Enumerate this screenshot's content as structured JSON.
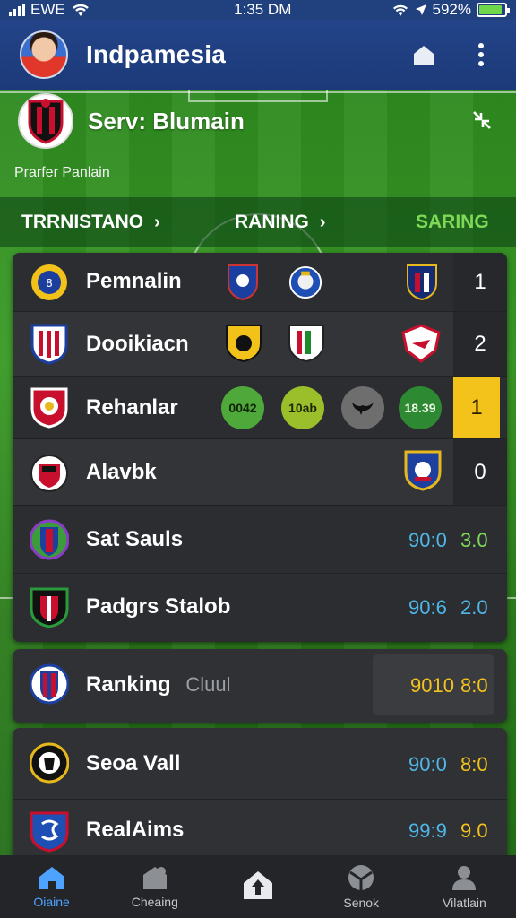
{
  "status_bar": {
    "carrier": "EWE",
    "time": "1:35 DM",
    "battery": "592%"
  },
  "header": {
    "title": "Indpamesia",
    "icons": [
      "avatar",
      "home-outline-icon",
      "more-vertical-icon"
    ]
  },
  "hero": {
    "title": "Serv: Blumain",
    "subtitle": "Prarfer Panlain"
  },
  "tabs": [
    {
      "label": "TRRNISTANO",
      "chevron": "›"
    },
    {
      "label": "RANING",
      "chevron": "›"
    },
    {
      "label": "SARING"
    }
  ],
  "rows": [
    {
      "name": "Pemnalin",
      "rank": "1"
    },
    {
      "name": "Dooikiacn",
      "rank": "2"
    },
    {
      "name": "Rehanlar",
      "rank": "1",
      "pills": [
        "0042",
        "10ab",
        "",
        "18.39"
      ]
    },
    {
      "name": "Alavbk",
      "rank": "0"
    },
    {
      "name": "Sat Sauls",
      "score_a": "90:0",
      "score_b": "3.0"
    },
    {
      "name": "Padgrs Stalob",
      "score_a": "90:6",
      "score_b": "2.0"
    }
  ],
  "featured": {
    "name": "Ranking",
    "suffix": "Cluul",
    "score_a": "9010",
    "score_b": "8:0"
  },
  "lower_rows": [
    {
      "name": "Seoa Vall",
      "score_a": "90:0",
      "score_b": "8:0"
    },
    {
      "name": "RealAims",
      "score_a": "99:9",
      "score_b": "9.0"
    }
  ],
  "nav": [
    {
      "label": "Oiaine",
      "icon": "home-icon"
    },
    {
      "label": "Cheaing",
      "icon": "shop-icon"
    },
    {
      "label": "",
      "icon": "upload-icon"
    },
    {
      "label": "Senok",
      "icon": "ball-icon"
    },
    {
      "label": "Vilatlain",
      "icon": "profile-icon"
    }
  ],
  "colors": {
    "accent": "#4da3ff",
    "highlight": "#f3c21b",
    "score_blue": "#4fb7e8",
    "score_green": "#7ed957",
    "score_yellow": "#f3c21b"
  }
}
